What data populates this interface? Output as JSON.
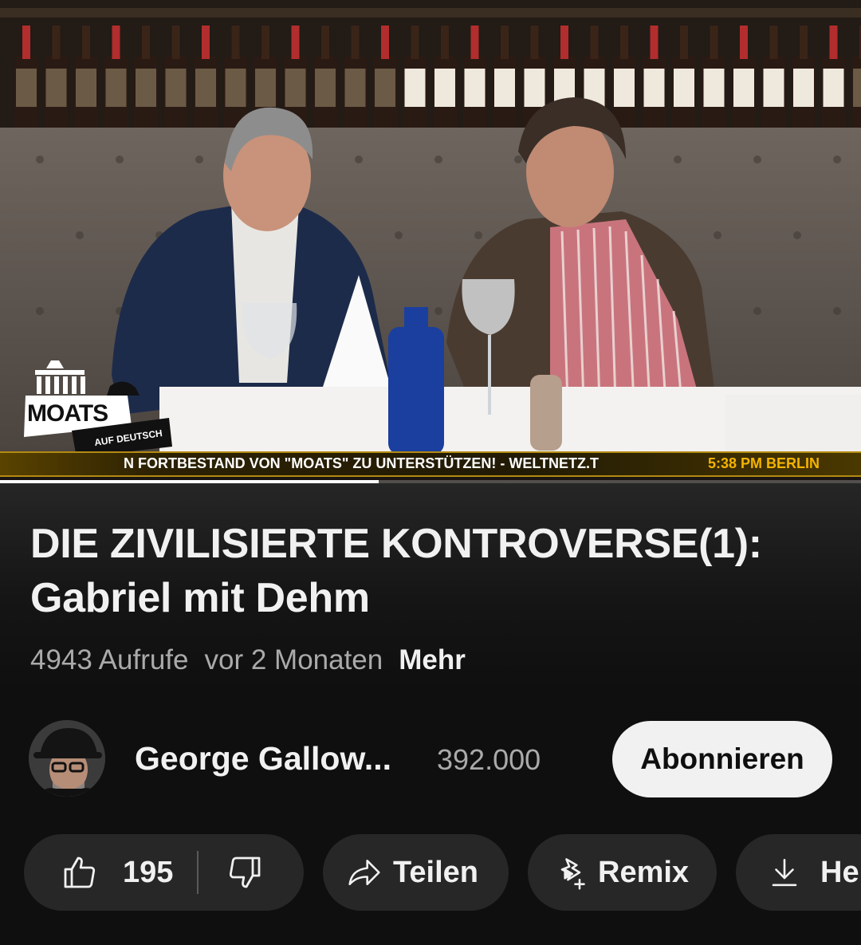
{
  "player": {
    "overlay_logo": {
      "title": "MOATS",
      "subtitle": "AUF DEUTSCH"
    },
    "ticker": {
      "text": "N FORTBESTAND VON \"MOATS\" ZU UNTERSTÜTZEN! - WELTNETZ.T",
      "time": "5:38 PM BERLIN"
    },
    "progress_fraction": 0.44
  },
  "video": {
    "title_line1": "DIE ZIVILISIERTE KONTROVERSE(1):",
    "title_line2": "Gabriel mit Dehm",
    "views": "4943 Aufrufe",
    "age": "vor 2 Monaten",
    "more_label": "Mehr"
  },
  "channel": {
    "name": "George Gallow...",
    "subscribers": "392.000",
    "subscribe_label": "Abonnieren"
  },
  "actions": {
    "like_count": "195",
    "share_label": "Teilen",
    "remix_label": "Remix",
    "download_label": "Her"
  },
  "colors": {
    "background": "#0f0f0f",
    "pill": "#272727",
    "ticker_time": "#f4b400",
    "subscribe_bg": "#f1f1f1"
  },
  "icons": [
    "thumbs-up-icon",
    "thumbs-down-icon",
    "share-arrow-icon",
    "remix-icon",
    "download-icon"
  ]
}
